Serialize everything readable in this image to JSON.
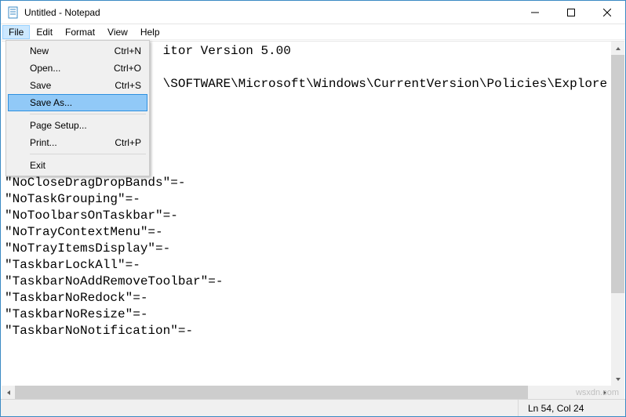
{
  "window": {
    "title": "Untitled - Notepad"
  },
  "menubar": {
    "items": [
      "File",
      "Edit",
      "Format",
      "View",
      "Help"
    ],
    "active_index": 0
  },
  "file_menu": {
    "items": [
      {
        "label": "New",
        "shortcut": "Ctrl+N"
      },
      {
        "label": "Open...",
        "shortcut": "Ctrl+O"
      },
      {
        "label": "Save",
        "shortcut": "Ctrl+S"
      },
      {
        "label": "Save As...",
        "shortcut": "",
        "highlight": true
      },
      {
        "sep": true
      },
      {
        "label": "Page Setup...",
        "shortcut": ""
      },
      {
        "label": "Print...",
        "shortcut": "Ctrl+P"
      },
      {
        "sep": true
      },
      {
        "label": "Exit",
        "shortcut": ""
      }
    ]
  },
  "editor": {
    "lines": [
      "                     itor Version 5.00",
      "",
      "                     \\SOFTWARE\\Microsoft\\Windows\\CurrentVersion\\Policies\\Explore",
      "",
      "",
      "",
      "",
      "",
      "\"NoCloseDragDropBands\"=-",
      "\"NoTaskGrouping\"=-",
      "\"NoToolbarsOnTaskbar\"=-",
      "\"NoTrayContextMenu\"=-",
      "\"NoTrayItemsDisplay\"=-",
      "\"TaskbarLockAll\"=-",
      "\"TaskbarNoAddRemoveToolbar\"=-",
      "\"TaskbarNoRedock\"=-",
      "\"TaskbarNoResize\"=-",
      "\"TaskbarNoNotification\"=-"
    ]
  },
  "status": {
    "position": "Ln 54, Col 24"
  },
  "watermark": "wsxdn.com"
}
